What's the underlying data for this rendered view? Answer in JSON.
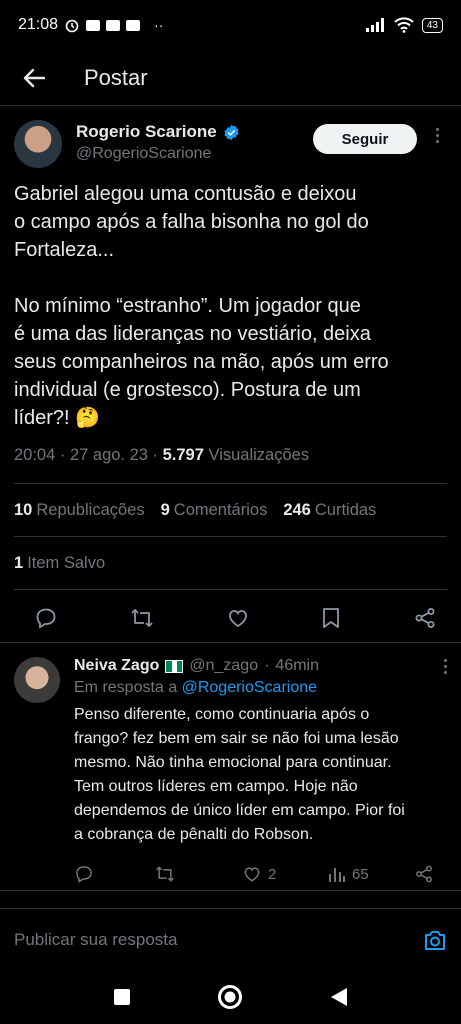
{
  "status_bar": {
    "time": "21:08",
    "battery": "43"
  },
  "header": {
    "title": "Postar"
  },
  "tweet": {
    "author_name": "Rogerio Scarione",
    "author_handle": "@RogerioScarione",
    "follow_label": "Seguir",
    "text": "Gabriel alegou uma contusão e deixou\no campo após a falha bisonha no gol do\nFortaleza...\n\nNo mínimo “estranho”. Um jogador que\né uma das lideranças no vestiário, deixa\nseus companheiros na mão, após um erro\nindividual (e grostesco). Postura de um\nlíder?! 🤔",
    "datetime": "20:04 · 27 ago. 23 · ",
    "views_count": "5.797",
    "views_label": " Visualizações",
    "reposts_count": "10",
    "reposts_label": "Republicações",
    "comments_count": "9",
    "comments_label": "Comentários",
    "likes_count": "246",
    "likes_label": "Curtidas",
    "saved_count": "1",
    "saved_label": "Item Salvo"
  },
  "reply": {
    "name": "Neiva Zago",
    "handle": "@n_zago",
    "time": "46min",
    "in_reply_prefix": "Em resposta a ",
    "in_reply_mention": "@RogerioScarione",
    "text": "Penso diferente, como continuaria após o\nfrango? fez bem em sair se não foi uma lesão\nmesmo. Não tinha emocional para continuar.\nTem outros líderes em campo. Hoje não\ndependemos de único líder em campo. Pior foi\na cobrança de pênalti do Robson.",
    "likes": "2",
    "views": "65"
  },
  "compose": {
    "placeholder": "Publicar sua resposta"
  },
  "colors": {
    "accent": "#1d9bf0",
    "background": "#000000",
    "muted": "#71767b",
    "text": "#e7e9ea"
  }
}
